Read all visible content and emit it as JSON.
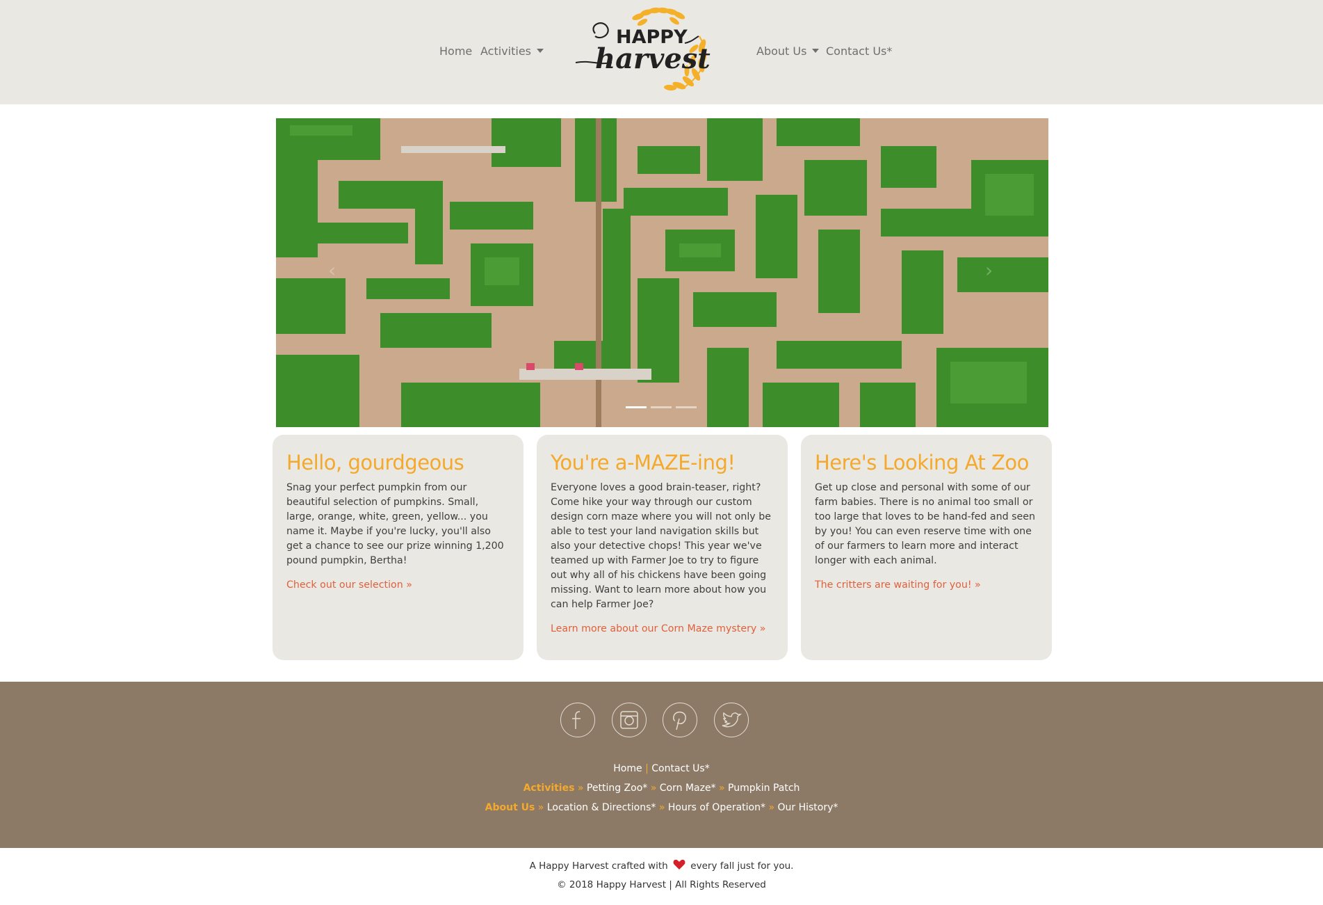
{
  "nav": {
    "home": "Home",
    "activities": "Activities",
    "about": "About Us",
    "contact": "Contact Us*"
  },
  "logo": {
    "line1": "HAPPY",
    "line2": "harvest"
  },
  "carousel": {
    "prev": "‹",
    "next": "›",
    "slide_count": 3,
    "active_index": 0
  },
  "cards": [
    {
      "title": "Hello, gourdgeous",
      "text": "Snag your perfect pumpkin from our beautiful selection of pumpkins. Small, large, orange, white, green, yellow... you name it. Maybe if you're lucky, you'll also get a chance to see our prize winning 1,200 pound pumpkin, Bertha!",
      "link": "Check out our selection »"
    },
    {
      "title": "You're a-MAZE-ing!",
      "text": "Everyone loves a good brain-teaser, right? Come hike your way through our custom design corn maze where you will not only be able to test your land navigation skills but also your detective chops! This year we've teamed up with Farmer Joe to try to figure out why all of his chickens have been going missing. Want to learn more about how you can help Farmer Joe?",
      "link": "Learn more about our Corn Maze mystery »"
    },
    {
      "title": "Here's Looking At Zoo",
      "text": "Get up close and personal with some of our farm babies. There is no animal too small or too large that loves to be hand-fed and seen by you! You can even reserve time with one of our farmers to learn more and interact longer with each animal.",
      "link": "The critters are waiting for you! »"
    }
  ],
  "footer": {
    "social": [
      "facebook-icon",
      "instagram-icon",
      "pinterest-icon",
      "twitter-icon"
    ],
    "row1": {
      "home": "Home",
      "sep": "|",
      "contact": "Contact Us*"
    },
    "row2": {
      "head": "Activities",
      "arrow": "»",
      "items": [
        "Petting Zoo*",
        "Corn Maze*",
        "Pumpkin Patch"
      ]
    },
    "row3": {
      "head": "About Us",
      "arrow": "»",
      "items": [
        "Location & Directions*",
        "Hours of Operation*",
        "Our History*"
      ]
    }
  },
  "bottom": {
    "line1_before": "A Happy Harvest crafted with",
    "line1_after": "every fall just for you.",
    "line2": "© 2018 Happy Harvest | All Rights Reserved"
  },
  "colors": {
    "header_bg": "#eae8e2",
    "accent": "#f4a92c",
    "link": "#e0603c",
    "footer_bg": "#8d7a66"
  }
}
